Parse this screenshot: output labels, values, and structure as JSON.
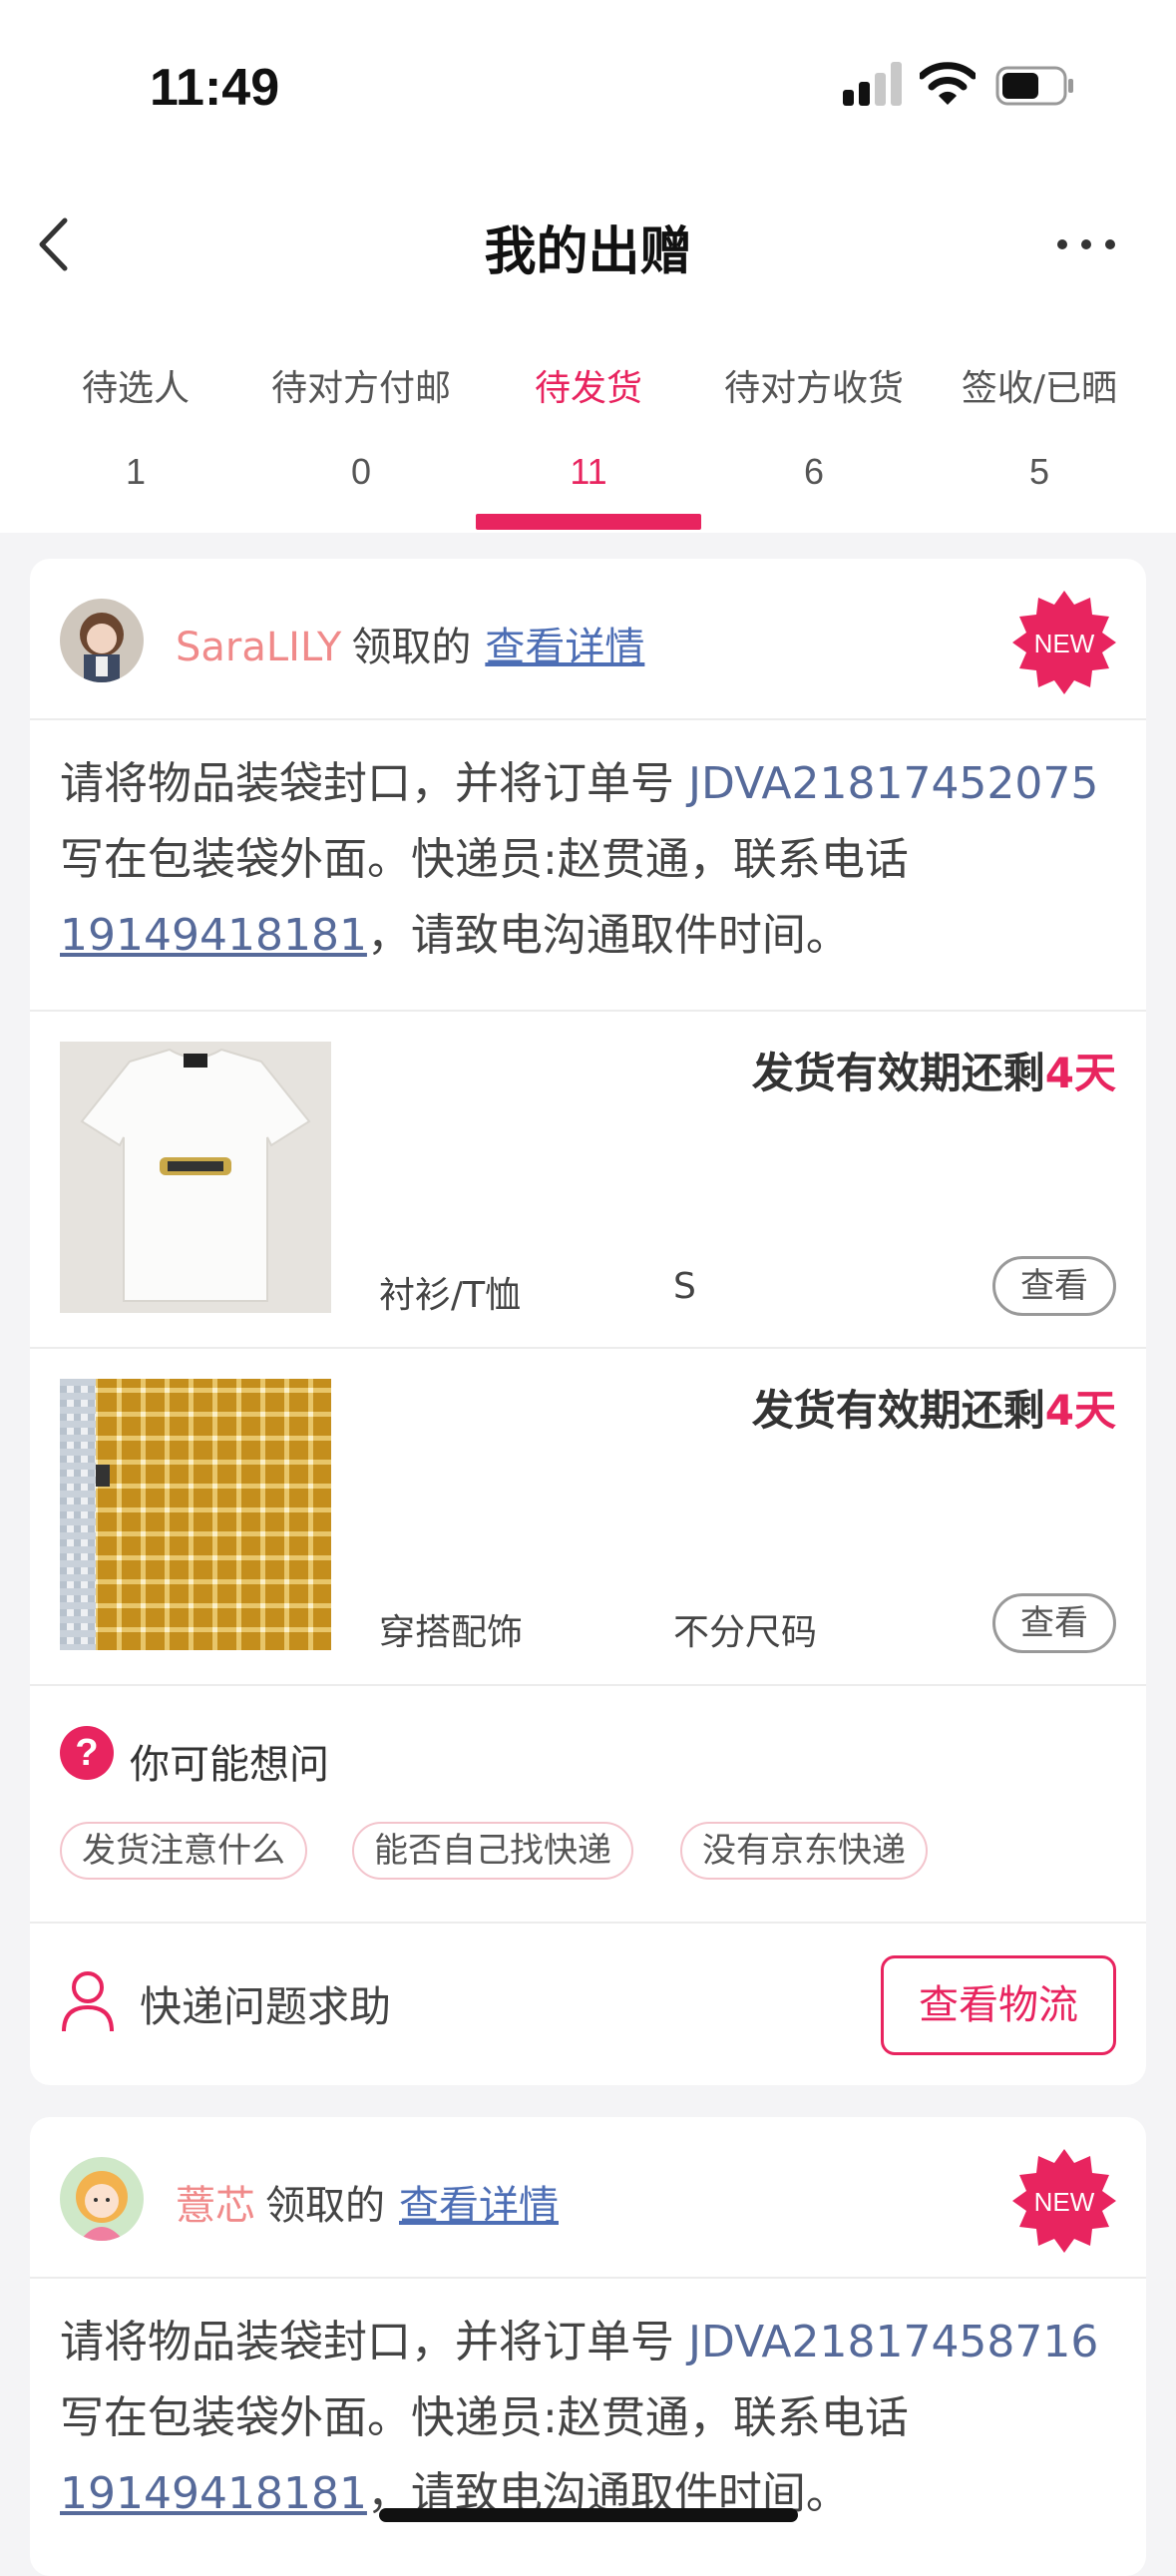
{
  "status_bar": {
    "time": "11:49"
  },
  "nav": {
    "title": "我的出赠"
  },
  "tabs": [
    {
      "label": "待选人",
      "count": "1"
    },
    {
      "label": "待对方付邮",
      "count": "0"
    },
    {
      "label": "待发货",
      "count": "11"
    },
    {
      "label": "待对方收货",
      "count": "6"
    },
    {
      "label": "签收/已晒",
      "count": "5"
    }
  ],
  "active_tab": "待发货",
  "colors": {
    "accent": "#e8245f",
    "username": "#f08a8a",
    "link": "#4d6eb5"
  },
  "orders": [
    {
      "username": "SaraLILY",
      "received_label": "领取的",
      "detail_link": "查看详情",
      "badge": "NEW",
      "note": {
        "prefix": "请将物品装袋封口，并将订单号 ",
        "order_no": "JDVA21817452075",
        "middle": " 写在包装袋外面。快递员:赵贯通，联系电话",
        "phone": "19149418181",
        "suffix": "，请致电沟通取件时间。"
      },
      "items": [
        {
          "deadline_prefix": "发货有效期还剩",
          "deadline_days": "4天",
          "category": "衬衫/T恤",
          "size": "S",
          "view_label": "查看"
        },
        {
          "deadline_prefix": "发货有效期还剩",
          "deadline_days": "4天",
          "category": "穿搭配饰",
          "size": "不分尺码",
          "view_label": "查看"
        }
      ],
      "faq": {
        "title": "你可能想问",
        "chips": [
          "发货注意什么",
          "能否自己找快递",
          "没有京东快递"
        ]
      },
      "help": {
        "label": "快递问题求助",
        "logistics_button": "查看物流"
      }
    },
    {
      "username": "薏芯",
      "received_label": "领取的",
      "detail_link": "查看详情",
      "badge": "NEW",
      "note": {
        "prefix": "请将物品装袋封口，并将订单号 ",
        "order_no": "JDVA21817458716",
        "middle": " 写在包装袋外面。快递员:赵贯通，联系电话",
        "phone": "19149418181",
        "suffix": "，请致电沟通取件时间。"
      }
    }
  ]
}
